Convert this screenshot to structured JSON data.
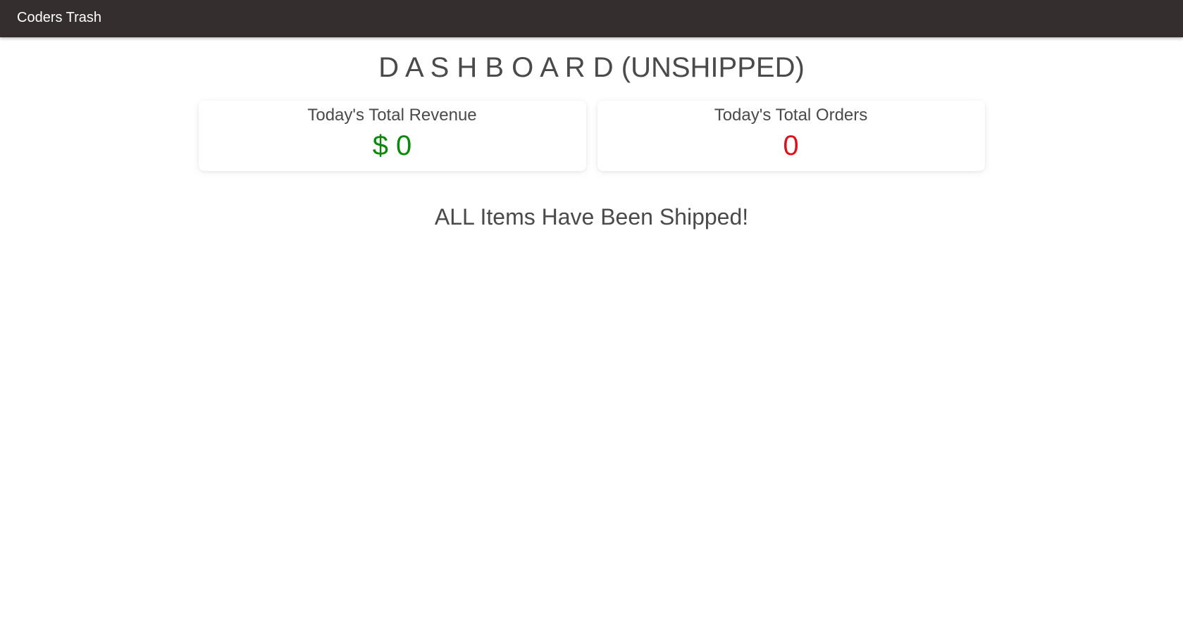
{
  "navbar": {
    "brand": "Coders Trash"
  },
  "page": {
    "title": "D A S H B O A R D (UNSHIPPED)"
  },
  "cards": {
    "revenue": {
      "label": "Today's Total Revenue",
      "value": "$ 0"
    },
    "orders": {
      "label": "Today's Total Orders",
      "value": "0"
    }
  },
  "status": {
    "message": "ALL Items Have Been Shipped!"
  },
  "colors": {
    "navbar_bg": "#342e2e",
    "revenue_green": "#0a8a0a",
    "orders_red": "#e0101a",
    "text_gray": "#4a4a4a"
  }
}
